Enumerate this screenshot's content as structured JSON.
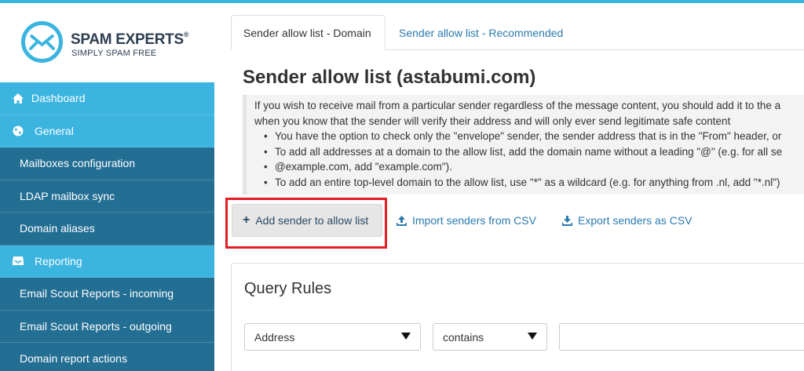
{
  "brand": {
    "name": "SPAM EXPERTS",
    "registered": "®",
    "tagline": "SIMPLY SPAM FREE",
    "accent": "#3bb4e0",
    "nav_dark": "#236e93",
    "highlight": "#e31b23"
  },
  "sidebar": {
    "items": [
      {
        "label": "Dashboard",
        "icon": "home-icon",
        "kind": "section"
      },
      {
        "label": "General",
        "icon": "globe-icon",
        "kind": "section"
      },
      {
        "label": "Mailboxes configuration",
        "kind": "sub"
      },
      {
        "label": "LDAP mailbox sync",
        "kind": "sub"
      },
      {
        "label": "Domain aliases",
        "kind": "sub"
      },
      {
        "label": "Reporting",
        "icon": "inbox-icon",
        "kind": "section"
      },
      {
        "label": "Email Scout Reports - incoming",
        "kind": "sub"
      },
      {
        "label": "Email Scout Reports - outgoing",
        "kind": "sub"
      },
      {
        "label": "Domain report actions",
        "kind": "sub"
      }
    ]
  },
  "tabs": [
    {
      "label": "Sender allow list - Domain",
      "active": true
    },
    {
      "label": "Sender allow list - Recommended",
      "active": false
    }
  ],
  "page": {
    "title": "Sender allow list (astabumi.com)",
    "info": {
      "line1": "If you wish to receive mail from a particular sender regardless of the message content, you should add it to the a",
      "line2": "when you know that the sender will verify their address and will only ever send legitimate safe content",
      "bullets": [
        "You have the option to check only the \"envelope\" sender, the sender address that is in the \"From\" header, or",
        "To add all addresses at a domain to the allow list, add the domain name without a leading \"@\" (e.g. for all se",
        "@example.com, add \"example.com\").",
        "To add an entire top-level domain to the allow list, use \"*\" as a wildcard (e.g. for anything from .nl, add \"*.nl\")"
      ]
    }
  },
  "actions": {
    "add_label": "Add sender to allow list",
    "import_label": "Import senders from CSV",
    "export_label": "Export senders as CSV"
  },
  "query": {
    "title": "Query Rules",
    "field_select": "Address",
    "operator_select": "contains",
    "value": ""
  }
}
